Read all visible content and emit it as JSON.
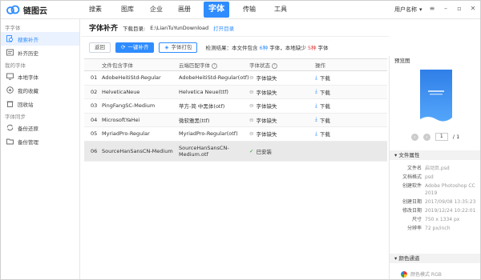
{
  "app": {
    "name": "链图云"
  },
  "nav": [
    {
      "label": "搜素"
    },
    {
      "label": "图库"
    },
    {
      "label": "企业"
    },
    {
      "label": "画册"
    },
    {
      "label": "字体"
    },
    {
      "label": "传输"
    },
    {
      "label": "工具"
    }
  ],
  "user": {
    "name": "用户名称"
  },
  "sidebar": {
    "sections": [
      {
        "title": "字字体",
        "items": [
          {
            "label": "搜索补齐"
          },
          {
            "label": "补齐历史"
          }
        ]
      },
      {
        "title": "我的字体",
        "items": [
          {
            "label": "本地字体"
          },
          {
            "label": "我的收藏"
          },
          {
            "label": "回收站"
          }
        ]
      },
      {
        "title": "字体同步",
        "items": [
          {
            "label": "备份还原"
          },
          {
            "label": "备份管理"
          }
        ]
      }
    ]
  },
  "header": {
    "title": "字体补齐",
    "download_label": "下载目录:",
    "download_path": "E:\\LianTuYunDownload",
    "open_dir": "打开目录"
  },
  "toolbar": {
    "back": "返回",
    "one_click": "一键补齐",
    "pack": "字体打包",
    "stats_prefix": "检测结果：本文件包含",
    "stats_total": "6种",
    "stats_mid": "字体，本地缺少",
    "stats_missing": "5种",
    "stats_suffix": "字体"
  },
  "table": {
    "headers": {
      "font": "文件包含字体",
      "match": "云端匹配字体",
      "status": "字体状态",
      "op": "操作"
    },
    "rows": [
      {
        "no": "01",
        "font": "AdobeHeitiStd-Regular",
        "match": "AdobeHeitiStd-Regular(otf)",
        "status": "字体缺失",
        "op": "下载"
      },
      {
        "no": "02",
        "font": "HelveticaNeue",
        "match": "Helvetica Neue(ttf)",
        "status": "字体缺失",
        "op": "下载"
      },
      {
        "no": "03",
        "font": "PingFangSC-Medium",
        "match": "苹方-简 中黑体(otf)",
        "status": "字体缺失",
        "op": "下载"
      },
      {
        "no": "04",
        "font": "MicrosoftYaHei",
        "match": "微软雅黑(ttf)",
        "status": "字体缺失",
        "op": "下载"
      },
      {
        "no": "05",
        "font": "MyriadPro-Regular",
        "match": "MyriadPro-Regular(otf)",
        "status": "字体缺失",
        "op": "下载"
      },
      {
        "no": "06",
        "font": "SourceHanSansCN-Medium",
        "match_line1": "SourceHanSansCN-",
        "match_line2": "Medium.otf",
        "status": "已安装",
        "op": ""
      }
    ]
  },
  "preview": {
    "title": "预览图",
    "page_current": "1",
    "page_total": "1"
  },
  "props": {
    "title": "文件属性",
    "items": [
      {
        "k": "文件名",
        "v": "启动页.psd"
      },
      {
        "k": "文档格式",
        "v": "psd"
      },
      {
        "k": "创建软件",
        "v": "Adobe Photoshop CC 2019"
      },
      {
        "k": "创建日期",
        "v": "2017/09/08 13:35:23"
      },
      {
        "k": "修改日期",
        "v": "2019/12/24 10:22:01"
      },
      {
        "k": "尺寸",
        "v": "750 x 1334 px"
      },
      {
        "k": "分辨率",
        "v": "72 px/inch"
      }
    ]
  },
  "color": {
    "title": "颜色通道",
    "mode": "颜色模式 RGB"
  },
  "colors": {
    "accent": "#2f8cff",
    "missing": "#d33333",
    "ok": "#2a9d2a"
  }
}
